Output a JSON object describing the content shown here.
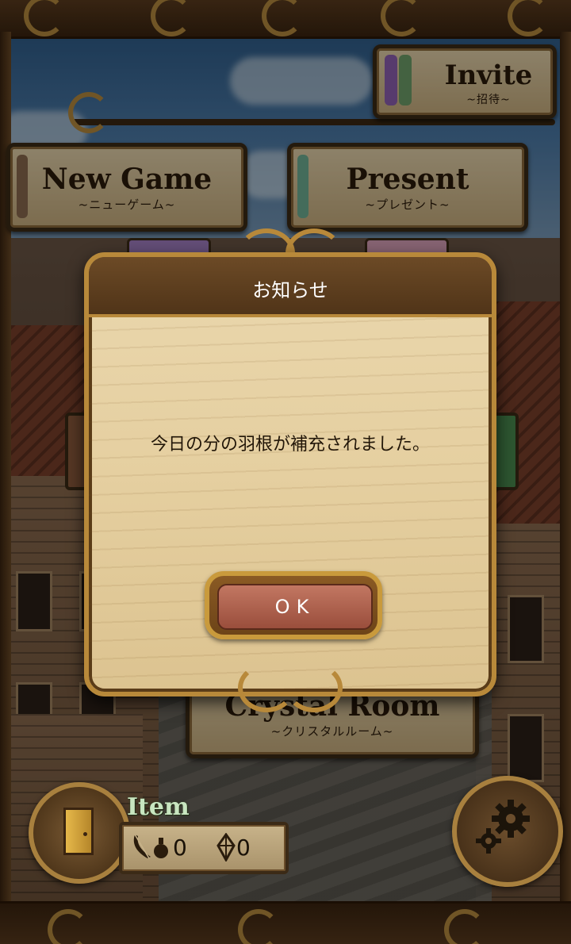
{
  "menu": {
    "invite": {
      "title": "Invite",
      "subtitle": "~招待~"
    },
    "new_game": {
      "title": "New Game",
      "subtitle": "~ニューゲーム~"
    },
    "present": {
      "title": "Present",
      "subtitle": "~プレゼント~"
    },
    "crystal_room": {
      "title": "Crystal Room",
      "subtitle": "~クリスタルルーム~"
    }
  },
  "dialog": {
    "title": "お知らせ",
    "message": "今日の分の羽根が補充されました。",
    "ok_label": "OK"
  },
  "hud": {
    "item_label": "Item",
    "feather_count": "0",
    "crystal_count": "0",
    "icons": [
      "door-icon",
      "feather-icon",
      "potion-icon",
      "crystal-icon",
      "gear-icon"
    ]
  },
  "colors": {
    "wood_light": "#e4d2ab",
    "frame_gold": "#b8893a",
    "ok_button": "#b0624e",
    "dialog_header": "#5e3f1e"
  }
}
